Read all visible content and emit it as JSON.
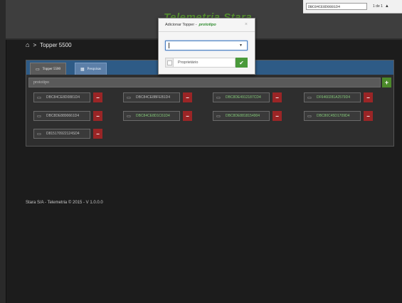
{
  "browser": {
    "find_text": "DBC84CE8D0881D4",
    "find_count": "1 de 1",
    "find_up": "▲"
  },
  "header": {
    "brand": "Telemetria Stara"
  },
  "breadcrumb": {
    "home_icon": "home-icon",
    "separator": ">",
    "label": "Topper 5500"
  },
  "tabs": [
    {
      "label": "Topper 5500",
      "icon": "monitor-icon",
      "active": true
    },
    {
      "label": "Pesquisas",
      "icon": "lock-icon",
      "active": false
    }
  ],
  "search": {
    "value": "prototipo"
  },
  "add_label": "+",
  "chips": [
    {
      "id": "DBC84CE8D0881D4",
      "green": false
    },
    {
      "id": "DBC84CE8BFEB1D4",
      "green": false
    },
    {
      "id": "DBC8DE4912187CD4",
      "green": true
    },
    {
      "id": "DF6460281A2579D4",
      "green": true
    },
    {
      "id": "DBC8DE8890661D4",
      "green": false
    },
    {
      "id": "DBC84CE8D1C61D4",
      "green": true
    },
    {
      "id": "DBC8DE8818154904",
      "green": true
    },
    {
      "id": "DBC80C45D1709D4",
      "green": true
    },
    {
      "id": "D815170922124SD4",
      "green": false
    }
  ],
  "chip_delete_label": "−",
  "footer": {
    "text": "Stara S/A - Telemetria  © 2015 - V 1.0.0.0"
  },
  "modal": {
    "title": "Adicionar Topper - ",
    "title_highlight": "prototipo",
    "close": "×",
    "select_arrow": "▼",
    "owner_label": "Proprietário",
    "ok_icon": "check-icon",
    "ok_symbol": "✔"
  },
  "colors": {
    "accent_blue": "#2e5b86",
    "success_green": "#4a9a3b",
    "danger_red": "#9a2526",
    "background": "#1c1c1c"
  }
}
